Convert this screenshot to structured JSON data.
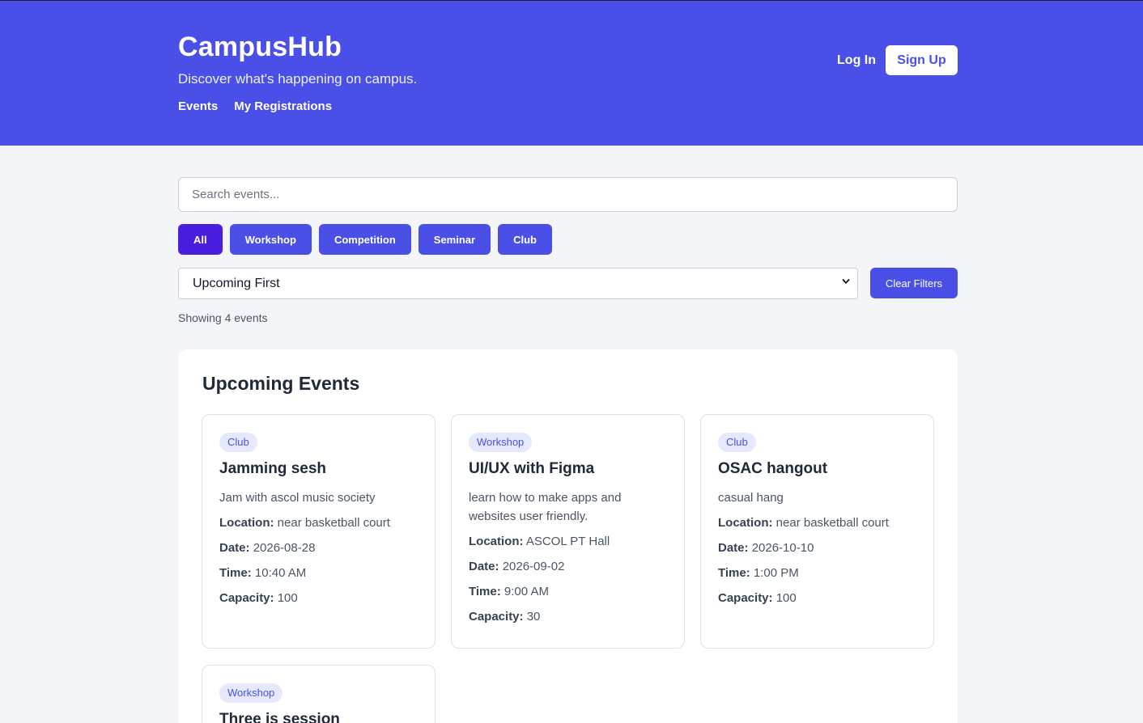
{
  "header": {
    "brand": "CampusHub",
    "tagline": "Discover what's happening on campus.",
    "nav": [
      "Events",
      "My Registrations"
    ],
    "login_label": "Log In",
    "signup_label": "Sign Up"
  },
  "search": {
    "placeholder": "Search events..."
  },
  "filters": {
    "categories": [
      "All",
      "Workshop",
      "Competition",
      "Seminar",
      "Club"
    ],
    "active": "All",
    "sort_value": "Upcoming First",
    "clear_label": "Clear Filters"
  },
  "results": {
    "count_text": "Showing 4 events"
  },
  "section": {
    "title": "Upcoming Events"
  },
  "labels": {
    "location": "Location:",
    "date": "Date:",
    "time": "Time:",
    "capacity": "Capacity:"
  },
  "events": [
    {
      "category": "Club",
      "title": "Jamming sesh",
      "description": "Jam with ascol music society",
      "location": "near basketball court",
      "date": "2026-08-28",
      "time": "10:40 AM",
      "capacity": "100"
    },
    {
      "category": "Workshop",
      "title": "UI/UX with Figma",
      "description": "learn how to make apps and websites user friendly.",
      "location": "ASCOL PT Hall",
      "date": "2026-09-02",
      "time": "9:00 AM",
      "capacity": "30"
    },
    {
      "category": "Club",
      "title": "OSAC hangout",
      "description": "casual hang",
      "location": "near basketball court",
      "date": "2026-10-10",
      "time": "1:00 PM",
      "capacity": "100"
    },
    {
      "category": "Workshop",
      "title": "Three is session"
    }
  ],
  "colors": {
    "primary": "#4a4fe8",
    "active_chip": "#4a1ee0",
    "badge_bg": "#e6e8fd",
    "page_bg": "#f4f5f9"
  }
}
